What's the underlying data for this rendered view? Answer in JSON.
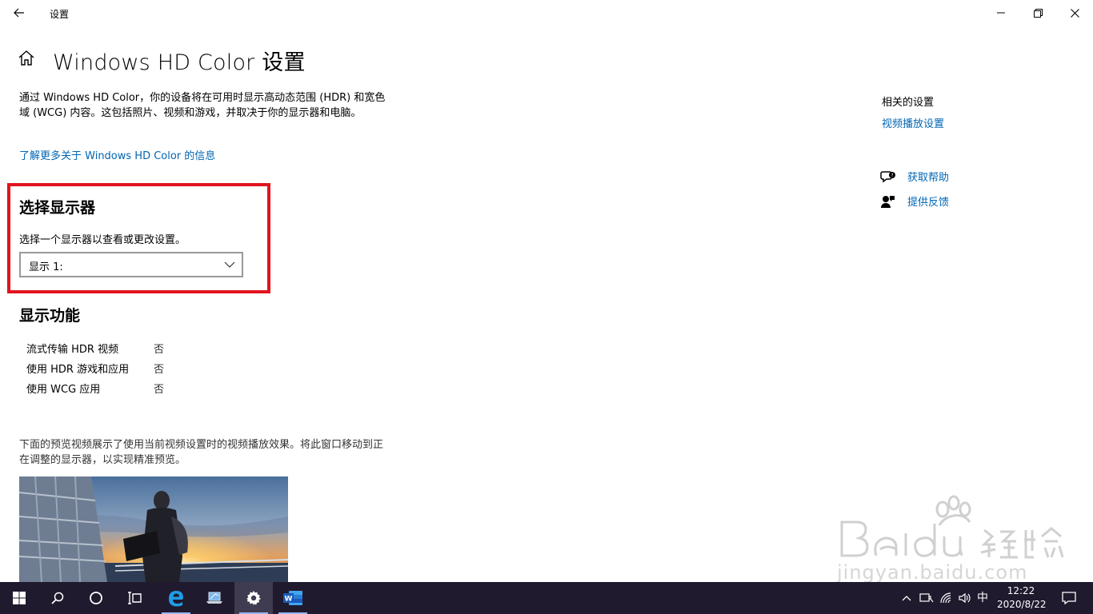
{
  "window": {
    "app_title": "设置",
    "icons": {
      "back": "back-arrow-icon",
      "minimize": "minimize-icon",
      "maximize": "restore-icon",
      "close": "close-icon"
    }
  },
  "header": {
    "page_title": "Windows HD Color 设置",
    "home_icon": "home-icon"
  },
  "intro": {
    "text": "通过 Windows HD Color，你的设备将在可用时显示高动态范围 (HDR) 和宽色域 (WCG) 内容。这包括照片、视频和游戏，并取决于你的显示器和电脑。",
    "learn_more_link": "了解更多关于 Windows HD Color 的信息"
  },
  "choose_display": {
    "title": "选择显示器",
    "description": "选择一个显示器以查看或更改设置。",
    "selected_value": "显示 1:",
    "highlight_color": "#e1141e"
  },
  "features": {
    "title": "显示功能",
    "rows": [
      {
        "label": "流式传输 HDR 视频",
        "value": "否"
      },
      {
        "label": "使用 HDR 游戏和应用",
        "value": "否"
      },
      {
        "label": "使用 WCG 应用",
        "value": "否"
      }
    ]
  },
  "preview": {
    "description": "下面的预览视频展示了使用当前视频设置时的视频播放效果。将此窗口移动到正在调整的显示器，以实现精准预览。"
  },
  "related": {
    "title": "相关的设置",
    "link": "视频播放设置",
    "get_help": "获取帮助",
    "feedback": "提供反馈",
    "link_color": "#0066b4"
  },
  "watermark": {
    "text": "jingyan.baidu.com"
  },
  "taskbar": {
    "ime": "中",
    "time": "12:22",
    "date": "2020/8/22",
    "background": "#1f1a2e",
    "apps": [
      "start-icon",
      "search-icon",
      "cortana-icon",
      "task-view-icon",
      "edge-icon",
      "laptop-app-icon",
      "settings-icon",
      "word-icon"
    ]
  }
}
